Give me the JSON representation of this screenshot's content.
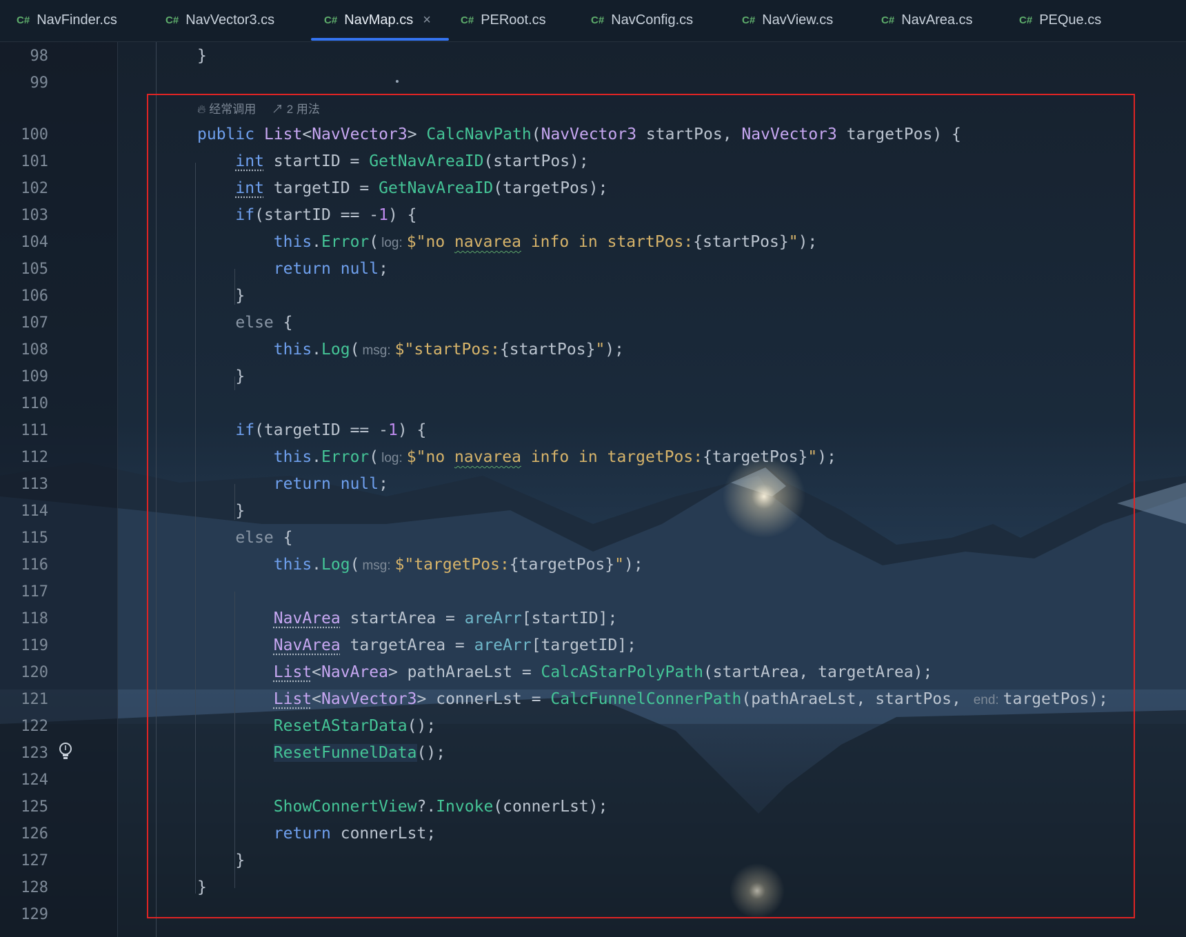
{
  "tabs": [
    {
      "lang": "C#",
      "label": "NavFinder.cs"
    },
    {
      "lang": "C#",
      "label": "NavVector3.cs"
    },
    {
      "lang": "C#",
      "label": "NavMap.cs",
      "active": true,
      "close": "×"
    },
    {
      "lang": "C#",
      "label": "PERoot.cs"
    },
    {
      "lang": "C#",
      "label": "NavConfig.cs"
    },
    {
      "lang": "C#",
      "label": "NavView.cs"
    },
    {
      "lang": "C#",
      "label": "NavArea.cs"
    },
    {
      "lang": "C#",
      "label": "PEQue.cs"
    }
  ],
  "line_numbers": [
    "98",
    "99",
    "100",
    "101",
    "102",
    "103",
    "104",
    "105",
    "106",
    "107",
    "108",
    "109",
    "110",
    "111",
    "112",
    "113",
    "114",
    "115",
    "116",
    "117",
    "118",
    "119",
    "120",
    "121",
    "122",
    "123",
    "124",
    "125",
    "126",
    "127",
    "128",
    "129"
  ],
  "code_lens": {
    "usage": "经常调用",
    "refs": "2 用法"
  },
  "hints": {
    "log": "log:",
    "msg": "msg:",
    "end": "end:"
  },
  "tokens": {
    "l98_close": "}",
    "l100_public": "public",
    "l100_list": "List",
    "l100_lt": "<",
    "l100_vec": "NavVector3",
    "l100_gt": ">",
    "l100_fn": "CalcNavPath",
    "l100_paren": "(",
    "l100_t1": "NavVector3",
    "l100_p1": " startPos, ",
    "l100_t2": "NavVector3",
    "l100_p2": " targetPos) {",
    "l101_int": "int",
    "l101_a": " startID = ",
    "l101_fn": "GetNavAreaID",
    "l101_b": "(startPos);",
    "l102_int": "int",
    "l102_a": " targetID = ",
    "l102_fn": "GetNavAreaID",
    "l102_b": "(targetPos);",
    "l103_if": "if",
    "l103_a": "(startID == -",
    "l103_num": "1",
    "l103_b": ") {",
    "this": "this",
    "dot": ".",
    "error": "Error",
    "paren": "(",
    "logfn": "Log",
    "l104_s1": "$\"no ",
    "navarea": "navarea",
    "l104_s2": " info in startPos:",
    "l104_i": "{startPos}",
    "l104_s3": "\"",
    "l104_end": ");",
    "return": "return",
    "null": "null",
    "semi": ";",
    "close": "}",
    "else": "else",
    "open": " {",
    "l108_s": "$\"startPos:",
    "l108_i": "{startPos}",
    "l108_q": "\"",
    "l108_end": ");",
    "l111_if": "if",
    "l111_a": "(targetID == -",
    "l111_num": "1",
    "l111_b": ") {",
    "l112_s2": " info in targetPos:",
    "l112_i": "{targetPos}",
    "l112_q": "\"",
    "l112_end": ");",
    "l116_s": "$\"targetPos:",
    "l116_i": "{targetPos}",
    "l116_q": "\"",
    "l116_end": ");",
    "navarea_t": "NavArea",
    "l118_a": " startArea = ",
    "arearr": "areArr",
    "l118_b": "[startID];",
    "l119_a": " targetArea = ",
    "l119_b": "[targetID];",
    "list": "List",
    "lt": "<",
    "gt": ">",
    "l120_a": " pathAraeLst = ",
    "l120_fn": "CalcAStarPolyPath",
    "l120_b": "(startArea, targetArea);",
    "navvector3": "NavVector3",
    "l121_a": " connerLst = ",
    "l121_fn": "CalcFunnelConnerPath",
    "l121_b": "(pathAraeLst, startPos, ",
    "l121_c": "targetPos);",
    "l122_fn": "ResetAStarData",
    "l122_b": "();",
    "l123_fn": "ResetFunnelData",
    "l123_b": "();",
    "l125_fn": "ShowConnertView",
    "l125_a": "?.",
    "l125_inv": "Invoke",
    "l125_b": "(connerLst);",
    "l126_b": " connerLst;"
  }
}
